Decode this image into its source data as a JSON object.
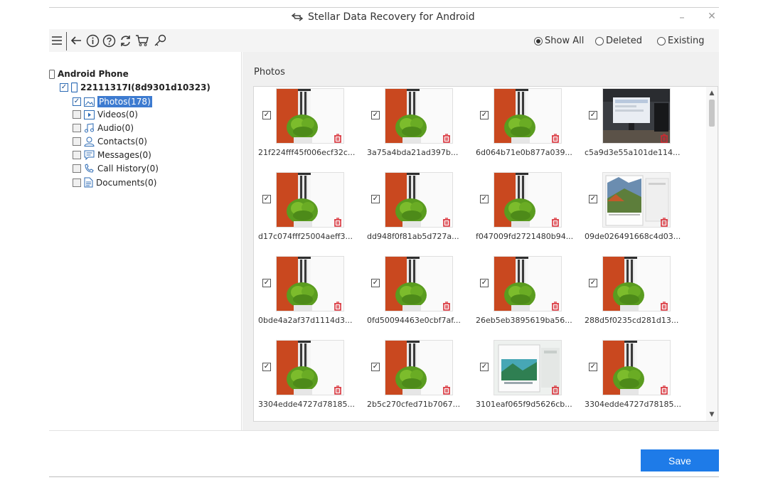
{
  "window": {
    "title": "Stellar Data Recovery for Android",
    "minimize_label": "–",
    "close_label": "✕"
  },
  "toolbar": {
    "icons": [
      "menu-icon",
      "back-icon",
      "info-icon",
      "help-icon",
      "refresh-icon",
      "cart-icon",
      "key-icon"
    ],
    "filters": [
      {
        "label": "Show All",
        "selected": true
      },
      {
        "label": "Deleted",
        "selected": false
      },
      {
        "label": "Existing",
        "selected": false
      }
    ]
  },
  "tree": {
    "root": "Android Phone",
    "device": "22111317I(8d9301d10323)",
    "categories": [
      {
        "label": "Photos(178)",
        "checked": true,
        "selected": true,
        "icon": "photo-icon"
      },
      {
        "label": "Videos(0)",
        "checked": false,
        "selected": false,
        "icon": "video-icon"
      },
      {
        "label": "Audio(0)",
        "checked": false,
        "selected": false,
        "icon": "audio-icon"
      },
      {
        "label": "Contacts(0)",
        "checked": false,
        "selected": false,
        "icon": "contact-icon"
      },
      {
        "label": "Messages(0)",
        "checked": false,
        "selected": false,
        "icon": "message-icon"
      },
      {
        "label": "Call History(0)",
        "checked": false,
        "selected": false,
        "icon": "call-history-icon"
      },
      {
        "label": "Documents(0)",
        "checked": false,
        "selected": false,
        "icon": "document-icon"
      }
    ]
  },
  "content": {
    "section_title": "Photos",
    "photos": [
      {
        "name": "21f224fff45f006ecf32c...",
        "image": "plant"
      },
      {
        "name": "3a75a4bda21ad397b...",
        "image": "plant"
      },
      {
        "name": "6d064b71e0b877a039...",
        "image": "plant"
      },
      {
        "name": "c5a9d3e55a101de114...",
        "image": "monitor"
      },
      {
        "name": "d17c074fff25004aeff3...",
        "image": "plant"
      },
      {
        "name": "dd948f0f81ab5d727a...",
        "image": "plant"
      },
      {
        "name": "f047009fd2721480b94...",
        "image": "plant"
      },
      {
        "name": "09de026491668c4d03...",
        "image": "calendar"
      },
      {
        "name": "0bde4a2af37d1114d3...",
        "image": "plant"
      },
      {
        "name": "0fd50094463e0cbf7af...",
        "image": "plant"
      },
      {
        "name": "26eb5eb3895619ba56...",
        "image": "plant"
      },
      {
        "name": "288d5f0235cd281d13...",
        "image": "plant"
      },
      {
        "name": "3304edde4727d78185...",
        "image": "plant"
      },
      {
        "name": "2b5c270cfed71b7067...",
        "image": "plant"
      },
      {
        "name": "3101eaf065f9d5626cb...",
        "image": "calendar2"
      },
      {
        "name": "3304edde4727d78185...",
        "image": "plant"
      }
    ]
  },
  "footer": {
    "save_label": "Save"
  },
  "colors": {
    "accent": "#1e7be8",
    "selection": "#3d7bd0",
    "trash": "#d8262f"
  }
}
